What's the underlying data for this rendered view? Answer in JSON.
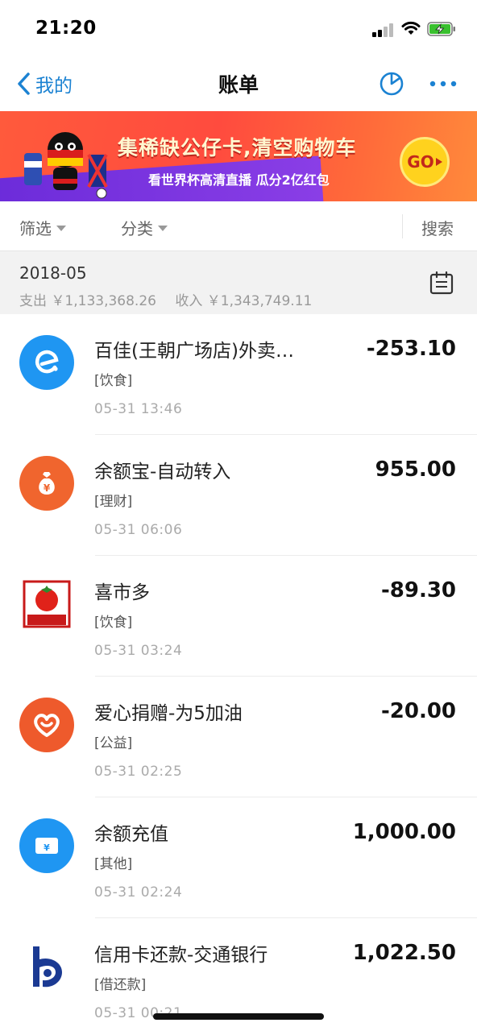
{
  "status_bar": {
    "time": "21:20"
  },
  "nav": {
    "back_label": "我的",
    "title": "账单"
  },
  "banner": {
    "title": "集稀缺公仔卡,清空购物车",
    "subtitle": "看世界杯高清直播 瓜分2亿红包",
    "go_label": "GO"
  },
  "filters": {
    "filter_label": "筛选",
    "category_label": "分类",
    "search_label": "搜索"
  },
  "month": {
    "label": "2018-05",
    "expense": "支出 ￥1,133,368.26",
    "income": "收入 ￥1,343,749.11"
  },
  "transactions": [
    {
      "name": "百佳(王朝广场店)外卖…",
      "category": "[饮食]",
      "time": "05-31  13:46",
      "amount": "-253.10",
      "icon": "eleme-icon",
      "color": "#1f96f2"
    },
    {
      "name": "余额宝-自动转入",
      "category": "[理财]",
      "time": "05-31  06:06",
      "amount": "955.00",
      "icon": "money-bag-icon",
      "color": "#f0652e"
    },
    {
      "name": "喜市多",
      "category": "[饮食]",
      "time": "05-31  03:24",
      "amount": "-89.30",
      "icon": "tomato-logo-icon",
      "icon_text": "喜市多",
      "color": "#c81a1a"
    },
    {
      "name": "爱心捐赠-为5加油",
      "category": "[公益]",
      "time": "05-31  02:25",
      "amount": "-20.00",
      "icon": "heart-icon",
      "color": "#ee5a2c"
    },
    {
      "name": "余额充值",
      "category": "[其他]",
      "time": "05-31  02:24",
      "amount": "1,000.00",
      "icon": "card-icon",
      "color": "#1f96f2"
    },
    {
      "name": "信用卡还款-交通银行",
      "category": "[借还款]",
      "time": "05-31  00:21",
      "amount": "1,022.50",
      "icon": "bocom-logo-icon",
      "color": "#1b3a93"
    }
  ],
  "colors": {
    "accent": "#1b82d2",
    "banner": "#ff5a3c"
  }
}
